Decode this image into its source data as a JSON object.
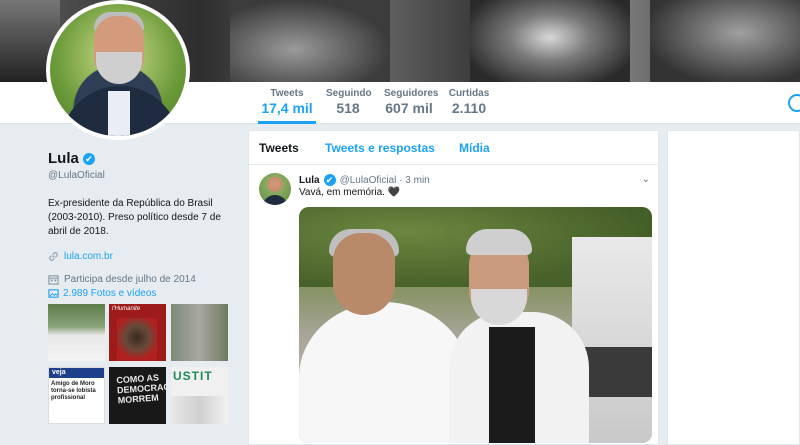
{
  "stats": [
    {
      "label": "Tweets",
      "value": "17,4 mil"
    },
    {
      "label": "Seguindo",
      "value": "518"
    },
    {
      "label": "Seguidores",
      "value": "607 mil"
    },
    {
      "label": "Curtidas",
      "value": "2.110"
    }
  ],
  "profile": {
    "name": "Lula",
    "verified_glyph": "✔",
    "handle": "@LulaOficial",
    "bio": "Ex-presidente da República do Brasil (2003-2010). Preso político desde 7 de abril de 2018.",
    "website": "lula.com.br",
    "joined": "Participa desde julho de 2014",
    "photos_label": "2.989 Fotos e vídeos"
  },
  "tiles": {
    "t2_caption": "l'Humanite",
    "t4_header": "veja",
    "t4_text": "Amigo de Moro torna-se lobista profissional",
    "t5_text": "COMO AS DEMOCRACIAS MORREM",
    "t6_text": "USTIT"
  },
  "feed": {
    "tabs": [
      "Tweets",
      "Tweets e respostas",
      "Mídia"
    ],
    "tweet": {
      "name": "Lula",
      "handle_time": "@LulaOficial · 3 min",
      "text": "Vavá, em memória. 🖤",
      "chevron": "⌄"
    }
  },
  "colors": {
    "accent": "#1da1f2",
    "background": "#e6ecf0",
    "text_secondary": "#657786"
  },
  "icons": {
    "verified": "verified-badge-icon",
    "link": "link-icon",
    "calendar": "calendar-icon",
    "photos": "image-icon",
    "chevron": "chevron-down-icon"
  }
}
